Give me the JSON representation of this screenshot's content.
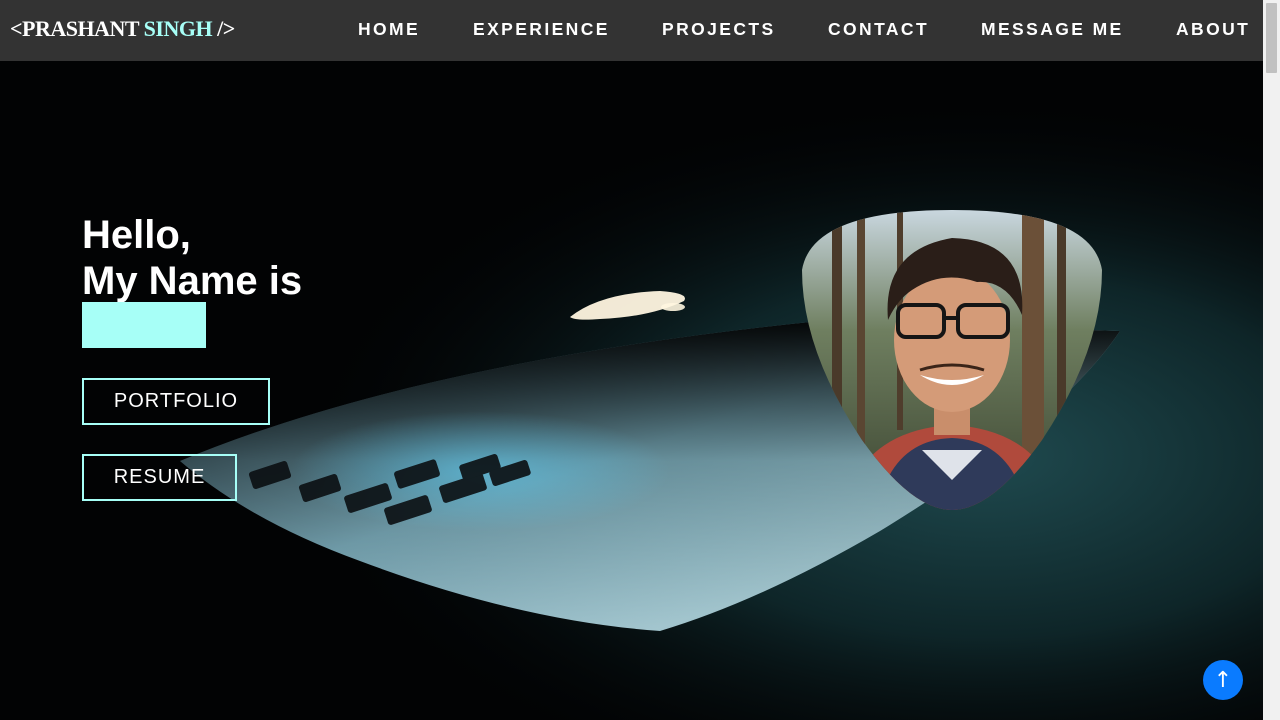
{
  "nav": {
    "logo_prefix": "<PRASHANT",
    "logo_accent": "SINGH",
    "logo_suffix": "/>",
    "links": [
      "HOME",
      "EXPERIENCE",
      "PROJECTS",
      "CONTACT",
      "MESSAGE ME",
      "ABOUT"
    ]
  },
  "hero": {
    "greeting_line1": "Hello,",
    "greeting_line2": "My Name is",
    "name_highlight": "",
    "portfolio_label": "PORTFOLIO",
    "resume_label": "RESUME"
  },
  "scroll_top": {
    "icon": "arrow-up-icon",
    "glyph": "↑"
  },
  "colors": {
    "nav_bg": "#333333",
    "accent": "#a7fff7",
    "scroll_button": "#0a7bff",
    "background": "#020304"
  }
}
